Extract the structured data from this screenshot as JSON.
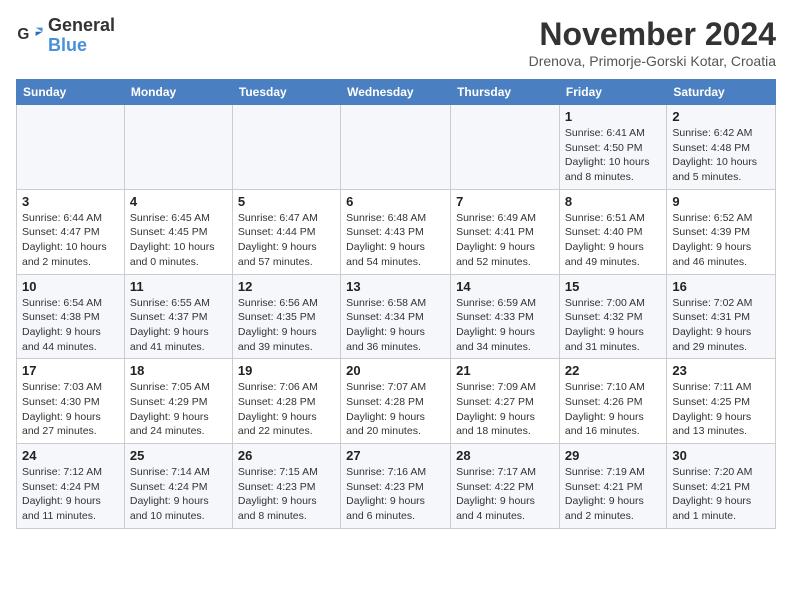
{
  "logo": {
    "line1": "General",
    "line2": "Blue"
  },
  "title": "November 2024",
  "location": "Drenova, Primorje-Gorski Kotar, Croatia",
  "weekdays": [
    "Sunday",
    "Monday",
    "Tuesday",
    "Wednesday",
    "Thursday",
    "Friday",
    "Saturday"
  ],
  "weeks": [
    [
      {
        "day": "",
        "info": ""
      },
      {
        "day": "",
        "info": ""
      },
      {
        "day": "",
        "info": ""
      },
      {
        "day": "",
        "info": ""
      },
      {
        "day": "",
        "info": ""
      },
      {
        "day": "1",
        "info": "Sunrise: 6:41 AM\nSunset: 4:50 PM\nDaylight: 10 hours\nand 8 minutes."
      },
      {
        "day": "2",
        "info": "Sunrise: 6:42 AM\nSunset: 4:48 PM\nDaylight: 10 hours\nand 5 minutes."
      }
    ],
    [
      {
        "day": "3",
        "info": "Sunrise: 6:44 AM\nSunset: 4:47 PM\nDaylight: 10 hours\nand 2 minutes."
      },
      {
        "day": "4",
        "info": "Sunrise: 6:45 AM\nSunset: 4:45 PM\nDaylight: 10 hours\nand 0 minutes."
      },
      {
        "day": "5",
        "info": "Sunrise: 6:47 AM\nSunset: 4:44 PM\nDaylight: 9 hours\nand 57 minutes."
      },
      {
        "day": "6",
        "info": "Sunrise: 6:48 AM\nSunset: 4:43 PM\nDaylight: 9 hours\nand 54 minutes."
      },
      {
        "day": "7",
        "info": "Sunrise: 6:49 AM\nSunset: 4:41 PM\nDaylight: 9 hours\nand 52 minutes."
      },
      {
        "day": "8",
        "info": "Sunrise: 6:51 AM\nSunset: 4:40 PM\nDaylight: 9 hours\nand 49 minutes."
      },
      {
        "day": "9",
        "info": "Sunrise: 6:52 AM\nSunset: 4:39 PM\nDaylight: 9 hours\nand 46 minutes."
      }
    ],
    [
      {
        "day": "10",
        "info": "Sunrise: 6:54 AM\nSunset: 4:38 PM\nDaylight: 9 hours\nand 44 minutes."
      },
      {
        "day": "11",
        "info": "Sunrise: 6:55 AM\nSunset: 4:37 PM\nDaylight: 9 hours\nand 41 minutes."
      },
      {
        "day": "12",
        "info": "Sunrise: 6:56 AM\nSunset: 4:35 PM\nDaylight: 9 hours\nand 39 minutes."
      },
      {
        "day": "13",
        "info": "Sunrise: 6:58 AM\nSunset: 4:34 PM\nDaylight: 9 hours\nand 36 minutes."
      },
      {
        "day": "14",
        "info": "Sunrise: 6:59 AM\nSunset: 4:33 PM\nDaylight: 9 hours\nand 34 minutes."
      },
      {
        "day": "15",
        "info": "Sunrise: 7:00 AM\nSunset: 4:32 PM\nDaylight: 9 hours\nand 31 minutes."
      },
      {
        "day": "16",
        "info": "Sunrise: 7:02 AM\nSunset: 4:31 PM\nDaylight: 9 hours\nand 29 minutes."
      }
    ],
    [
      {
        "day": "17",
        "info": "Sunrise: 7:03 AM\nSunset: 4:30 PM\nDaylight: 9 hours\nand 27 minutes."
      },
      {
        "day": "18",
        "info": "Sunrise: 7:05 AM\nSunset: 4:29 PM\nDaylight: 9 hours\nand 24 minutes."
      },
      {
        "day": "19",
        "info": "Sunrise: 7:06 AM\nSunset: 4:28 PM\nDaylight: 9 hours\nand 22 minutes."
      },
      {
        "day": "20",
        "info": "Sunrise: 7:07 AM\nSunset: 4:28 PM\nDaylight: 9 hours\nand 20 minutes."
      },
      {
        "day": "21",
        "info": "Sunrise: 7:09 AM\nSunset: 4:27 PM\nDaylight: 9 hours\nand 18 minutes."
      },
      {
        "day": "22",
        "info": "Sunrise: 7:10 AM\nSunset: 4:26 PM\nDaylight: 9 hours\nand 16 minutes."
      },
      {
        "day": "23",
        "info": "Sunrise: 7:11 AM\nSunset: 4:25 PM\nDaylight: 9 hours\nand 13 minutes."
      }
    ],
    [
      {
        "day": "24",
        "info": "Sunrise: 7:12 AM\nSunset: 4:24 PM\nDaylight: 9 hours\nand 11 minutes."
      },
      {
        "day": "25",
        "info": "Sunrise: 7:14 AM\nSunset: 4:24 PM\nDaylight: 9 hours\nand 10 minutes."
      },
      {
        "day": "26",
        "info": "Sunrise: 7:15 AM\nSunset: 4:23 PM\nDaylight: 9 hours\nand 8 minutes."
      },
      {
        "day": "27",
        "info": "Sunrise: 7:16 AM\nSunset: 4:23 PM\nDaylight: 9 hours\nand 6 minutes."
      },
      {
        "day": "28",
        "info": "Sunrise: 7:17 AM\nSunset: 4:22 PM\nDaylight: 9 hours\nand 4 minutes."
      },
      {
        "day": "29",
        "info": "Sunrise: 7:19 AM\nSunset: 4:21 PM\nDaylight: 9 hours\nand 2 minutes."
      },
      {
        "day": "30",
        "info": "Sunrise: 7:20 AM\nSunset: 4:21 PM\nDaylight: 9 hours\nand 1 minute."
      }
    ]
  ]
}
